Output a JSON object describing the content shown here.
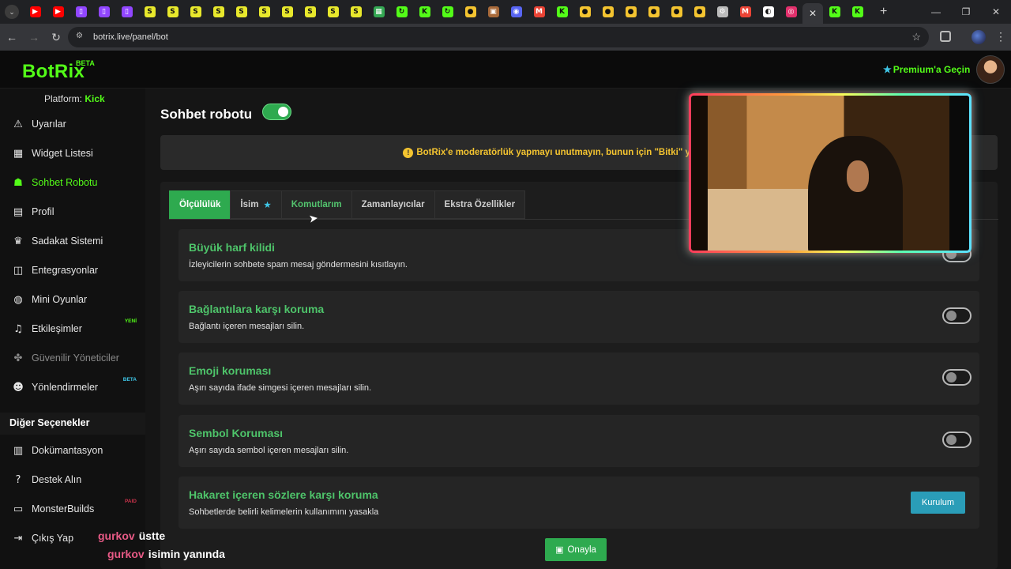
{
  "browser": {
    "tab_favicons": [
      {
        "icon": "youtube-icon",
        "color": "#ff0000",
        "glyph": "▶"
      },
      {
        "icon": "youtube-icon",
        "color": "#ff0000",
        "glyph": "▶"
      },
      {
        "icon": "twitch-icon",
        "color": "#9146ff",
        "glyph": "▯"
      },
      {
        "icon": "twitch-icon",
        "color": "#9146ff",
        "glyph": "▯"
      },
      {
        "icon": "twitch-icon",
        "color": "#9146ff",
        "glyph": "▯"
      },
      {
        "icon": "streamlabs-icon",
        "color": "#e8e82c",
        "glyph": "S"
      },
      {
        "icon": "streamlabs-icon",
        "color": "#e8e82c",
        "glyph": "S"
      },
      {
        "icon": "streamlabs-icon",
        "color": "#e8e82c",
        "glyph": "S"
      },
      {
        "icon": "streamlabs-icon",
        "color": "#e8e82c",
        "glyph": "S"
      },
      {
        "icon": "streamlabs-icon",
        "color": "#e8e82c",
        "glyph": "S"
      },
      {
        "icon": "streamlabs-icon",
        "color": "#e8e82c",
        "glyph": "S"
      },
      {
        "icon": "streamlabs-icon",
        "color": "#e8e82c",
        "glyph": "S"
      },
      {
        "icon": "streamlabs-icon",
        "color": "#e8e82c",
        "glyph": "S"
      },
      {
        "icon": "streamlabs-icon",
        "color": "#e8e82c",
        "glyph": "S"
      },
      {
        "icon": "streamlabs-icon",
        "color": "#e8e82c",
        "glyph": "S"
      },
      {
        "icon": "sheets-icon",
        "color": "#34a853",
        "glyph": "▦"
      },
      {
        "icon": "kick-app-icon",
        "color": "#53fc18",
        "glyph": "↻"
      },
      {
        "icon": "kick-icon",
        "color": "#53fc18",
        "glyph": "K"
      },
      {
        "icon": "kick-app-icon",
        "color": "#53fc18",
        "glyph": "↻"
      },
      {
        "icon": "botrix-icon",
        "color": "#f4c430",
        "glyph": "●"
      },
      {
        "icon": "image-icon",
        "color": "#a86a3a",
        "glyph": "▣"
      },
      {
        "icon": "discord-icon",
        "color": "#5865f2",
        "glyph": "◉"
      },
      {
        "icon": "gmail-icon",
        "color": "#ea4335",
        "glyph": "M"
      },
      {
        "icon": "kick-icon",
        "color": "#53fc18",
        "glyph": "K"
      },
      {
        "icon": "botrix-icon",
        "color": "#f4c430",
        "glyph": "●"
      },
      {
        "icon": "botrix-icon",
        "color": "#f4c430",
        "glyph": "●"
      },
      {
        "icon": "botrix-icon",
        "color": "#f4c430",
        "glyph": "●"
      },
      {
        "icon": "botrix-icon",
        "color": "#f4c430",
        "glyph": "●"
      },
      {
        "icon": "botrix-icon",
        "color": "#f4c430",
        "glyph": "●"
      },
      {
        "icon": "botrix-icon",
        "color": "#f4c430",
        "glyph": "●"
      },
      {
        "icon": "settings-gear-icon",
        "color": "#bbbbbb",
        "glyph": "⚙"
      },
      {
        "icon": "gmail-icon",
        "color": "#ea4335",
        "glyph": "M"
      },
      {
        "icon": "streamelements-icon",
        "color": "#ffffff",
        "glyph": "◐"
      },
      {
        "icon": "instagram-icon",
        "color": "#e1306c",
        "glyph": "◎"
      }
    ],
    "active_tab_close": "✕",
    "trailing_favicons": [
      {
        "icon": "kick-icon",
        "color": "#53fc18",
        "glyph": "K"
      },
      {
        "icon": "kick-icon",
        "color": "#53fc18",
        "glyph": "K"
      }
    ],
    "new_tab": "+",
    "url": "botrix.live/panel/bot"
  },
  "header": {
    "logo": "BotRix",
    "logo_badge": "BETA",
    "premium_label": "Premium'a Geçin"
  },
  "sidebar": {
    "platform_label": "Platform:",
    "platform_value": "Kick",
    "items": [
      {
        "label": "Uyarılar",
        "icon": "warning-triangle-icon",
        "glyph": "⚠",
        "state": "normal",
        "badge": ""
      },
      {
        "label": "Widget Listesi",
        "icon": "grid-icon",
        "glyph": "▦",
        "state": "normal",
        "badge": ""
      },
      {
        "label": "Sohbet Robotu",
        "icon": "android-robot-icon",
        "glyph": "☗",
        "state": "active",
        "badge": ""
      },
      {
        "label": "Profil",
        "icon": "id-card-icon",
        "glyph": "▤",
        "state": "normal",
        "badge": ""
      },
      {
        "label": "Sadakat Sistemi",
        "icon": "trophy-icon",
        "glyph": "♛",
        "state": "normal",
        "badge": ""
      },
      {
        "label": "Entegrasyonlar",
        "icon": "plug-icon",
        "glyph": "◫",
        "state": "normal",
        "badge": ""
      },
      {
        "label": "Mini Oyunlar",
        "icon": "gamepad-icon",
        "glyph": "◍",
        "state": "normal",
        "badge": ""
      },
      {
        "label": "Etkileşimler",
        "icon": "music-note-icon",
        "glyph": "♫",
        "state": "normal",
        "badge": "YENİ",
        "badge_kind": "yeni"
      },
      {
        "label": "Güvenilir Yöneticiler",
        "icon": "users-cog-icon",
        "glyph": "✤",
        "state": "disabled",
        "badge": ""
      },
      {
        "label": "Yönlendirmeler",
        "icon": "users-icon",
        "glyph": "☻",
        "state": "normal",
        "badge": "BETA",
        "badge_kind": "beta"
      }
    ],
    "other_heading": "Diğer Seçenekler",
    "other_items": [
      {
        "label": "Dokümantasyon",
        "icon": "book-icon",
        "glyph": "▥",
        "badge": ""
      },
      {
        "label": "Destek Alın",
        "icon": "question-circle-icon",
        "glyph": "?",
        "badge": ""
      },
      {
        "label": "MonsterBuilds",
        "icon": "laptop-icon",
        "glyph": "▭",
        "badge": "PAID",
        "badge_kind": "paid"
      },
      {
        "label": "Çıkış Yap",
        "icon": "sign-out-icon",
        "glyph": "⇥",
        "badge": ""
      }
    ]
  },
  "main": {
    "title": "Sohbet robotu",
    "bot_enabled": true,
    "alert": "BotRix'e moderatörlük yapmayı unutmayın, bunun için \"Bitki\" yazmanız yeterli",
    "tabs": [
      {
        "label": "Ölçülülük",
        "state": "active"
      },
      {
        "label": "İsim",
        "state": "normal",
        "has_star": true
      },
      {
        "label": "Komutlarım",
        "state": "link"
      },
      {
        "label": "Zamanlayıcılar",
        "state": "normal"
      },
      {
        "label": "Ekstra Özellikler",
        "state": "normal"
      }
    ],
    "settings": [
      {
        "title": "Büyük harf kilidi",
        "desc": "İzleyicilerin sohbete spam mesaj göndermesini kısıtlayın.",
        "control": "toggle",
        "enabled": false
      },
      {
        "title": "Bağlantılara karşı koruma",
        "desc": "Bağlantı içeren mesajları silin.",
        "control": "toggle",
        "enabled": false
      },
      {
        "title": "Emoji koruması",
        "desc": "Aşırı sayıda ifade simgesi içeren mesajları silin.",
        "control": "toggle",
        "enabled": false
      },
      {
        "title": "Sembol Koruması",
        "desc": "Aşırı sayıda sembol içeren mesajları silin.",
        "control": "toggle",
        "enabled": false
      },
      {
        "title": "Hakaret içeren sözlere karşı koruma",
        "desc": "Sohbetlerde belirli kelimelerin kullanımını yasakla",
        "control": "button",
        "button_label": "Kurulum"
      }
    ],
    "save_label": "Onayla"
  },
  "overlay": {
    "chat": [
      {
        "user": "gurkov",
        "message": "üstte"
      },
      {
        "user": "gurkov",
        "message": "isimin yanında"
      }
    ]
  },
  "colors": {
    "brand_green": "#53fc18",
    "active_green": "#2eaa4f",
    "setting_title": "#4ec46a",
    "alert_yellow": "#f4c430",
    "info_blue": "#2a9db8"
  }
}
